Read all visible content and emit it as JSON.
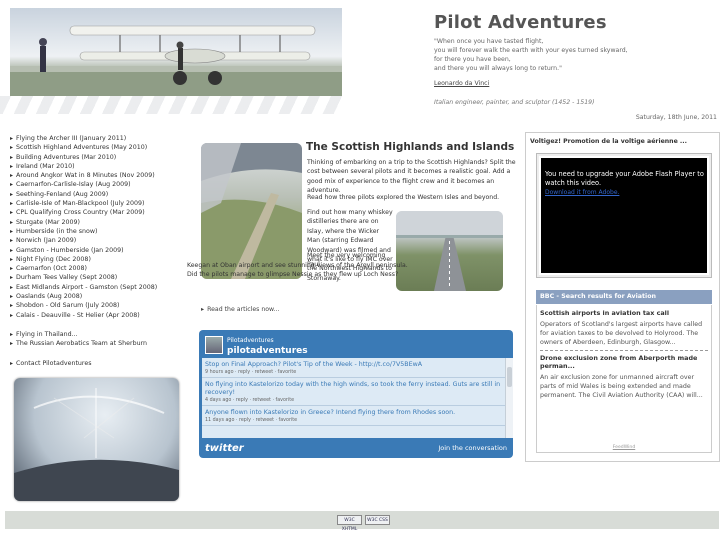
{
  "header": {
    "site_title": "Pilot Adventures",
    "quote_lines": [
      "\"When once you have tasted flight,",
      "you will forever walk the earth with your eyes turned skyward,",
      "for there you have been,",
      "and there you will always long to return.\""
    ],
    "author": "Leonardo da Vinci",
    "author_desc": "Italian engineer, painter, and sculptor (1452 - 1519)",
    "date": "Saturday, 18th June, 2011"
  },
  "sidebar": {
    "group1": [
      "Flying the Archer III (January 2011)",
      "Scottish Highland Adventures (May 2010)",
      "Building Adventures (Mar 2010)",
      "Ireland (Mar 2010)",
      "Around Angkor Wat in 8 Minutes (Nov 2009)",
      "Caernarfon-Carlisle-Islay (Aug 2009)",
      "Seething-Fenland (Aug 2009)",
      "Carlisle-Isle of Man-Blackpool (July 2009)",
      "CPL Qualifying Cross Country (Mar 2009)",
      "Sturgate (Mar 2009)",
      "Humberside (in the snow)",
      "Norwich (Jan 2009)",
      "Gamston - Humberside (Jan 2009)",
      "Night Flying (Dec 2008)",
      "Caernarfon (Oct 2008)",
      "Durham Tees Valley (Sept 2008)",
      "East Midlands Airport - Gamston (Sept 2008)",
      "Oaslands (Aug 2008)",
      "Shobdon - Old Sarum (July 2008)",
      "Calais - Deauville - St Helier (Apr 2008)"
    ],
    "group2": [
      "Flying in Thailand...",
      "The Russian Aerobatics Team at Sherburn"
    ],
    "group3": [
      "Contact Pilotadventures"
    ]
  },
  "article": {
    "title": "The Scottish Highlands and Islands",
    "para1": "Thinking of embarking on a trip to the Scottish Highlands? Split the cost between several pilots and it becomes a realistic goal. Add a good mix of experience to the flight crew and it becomes an adventure.",
    "para2": "Read how three pilots explored the Western Isles and beyond.",
    "para3": "Find out how many whiskey distilleries there are on Islay, where the Wicker Man (starring Edward Woodward) was filmed and what it's like to fly IMC over the Northwest Highlands to Stornaway.",
    "para4a": "Meet the very welcoming Paul",
    "para4b": "Keegan at Oban airport and see stunning views of the Argyll peninsula. Did the pilots manage to glimpse Nessie as they flew up Loch Ness?",
    "read_more": "Read the articles now..."
  },
  "twitter": {
    "user_small": "Pilotadventures",
    "user": "pilotadventures",
    "tweets": [
      {
        "text": "Stop on Final Approach? Pilot's Tip of the Week - http://t.co/7V5BEwA",
        "meta": "9 hours ago · reply · retweet · favorite"
      },
      {
        "text": "No flying into Kastelorizo today with the high winds, so took the ferry instead. Guts are still in recovery!",
        "meta": "4 days ago · reply · retweet · favorite"
      },
      {
        "text": "Anyone flown into Kastelorizo in Greece? Intend flying there from Rhodes soon.",
        "meta": "11 days ago · reply · retweet · favorite"
      }
    ],
    "logo": "twitter",
    "join": "Join the conversation"
  },
  "right": {
    "promo_title": "Voltigez! Promotion de la voltige aérienne ...",
    "flash_msg": "You need to upgrade your Adobe Flash Player to watch this video.",
    "flash_link": "Download it from Adobe.",
    "bbc_head": "BBC - Search results for Aviation",
    "items": [
      {
        "title": "Scottish airports in aviation tax call",
        "desc": "Operators of Scotland's largest airports have called for aviation taxes to be devolved to Holyrood. The owners of Aberdeen, Edinburgh, Glasgow..."
      },
      {
        "title": "Drone exclusion zone from Aberporth made perman...",
        "desc": "An air exclusion zone for unmanned aircraft over parts of mid Wales is being extended and made permanent. The Civil Aviation Authority (CAA) will..."
      }
    ],
    "feedwind": "FeedWind"
  },
  "footer": {
    "badges": [
      "W3C XHTML",
      "W3C CSS"
    ]
  }
}
